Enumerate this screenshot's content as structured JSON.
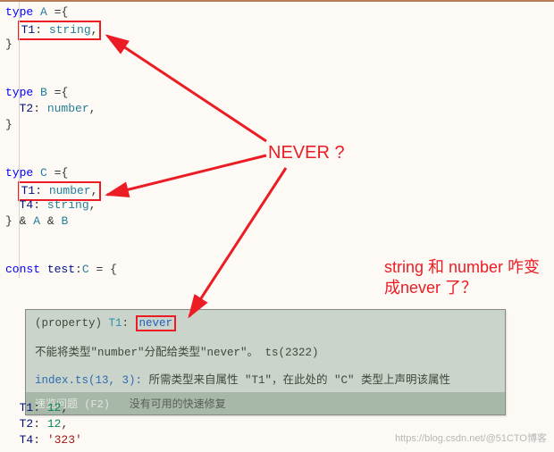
{
  "code": {
    "typeA": {
      "kw": "type",
      "name": "A",
      "eq": " ={",
      "field": "T1",
      "ftype": "string",
      "close": "}"
    },
    "typeB": {
      "kw": "type",
      "name": "B",
      "eq": " ={",
      "field": "T2",
      "ftype": "number",
      "close": "}"
    },
    "typeC": {
      "kw": "type",
      "name": "C",
      "eq": " ={",
      "f1": "T1",
      "f1t": "number",
      "f2": "T4",
      "f2t": "string",
      "close": "} & A & B"
    },
    "constDecl": {
      "kw": "const",
      "name": "test",
      "type": "C",
      "eq": " = {"
    },
    "body": {
      "l1a": "T1",
      "l1b": "12",
      "l2a": "T2",
      "l2b": "12",
      "l3a": "T4",
      "l3b": "'323'",
      "close": "}"
    }
  },
  "tooltip": {
    "sig_prefix": "(property) ",
    "sig_ident": "T1",
    "sig_colon": ": ",
    "sig_type": "never",
    "err1": "不能将类型\"number\"分配给类型\"never\"。 ts(2322)",
    "err2_pre": "index.ts(13, 3): ",
    "err2_body": "所需类型来自属性 \"T1\"，在此处的 \"C\" 类型上声明该属性",
    "quick_label": "速览问题 (F2)",
    "quick_msg": "没有可用的快速修复"
  },
  "annotations": {
    "never": "NEVER ?",
    "question": "string 和 number 咋变成never 了？"
  },
  "watermark": "https://blog.csdn.net/@51CTO博客"
}
